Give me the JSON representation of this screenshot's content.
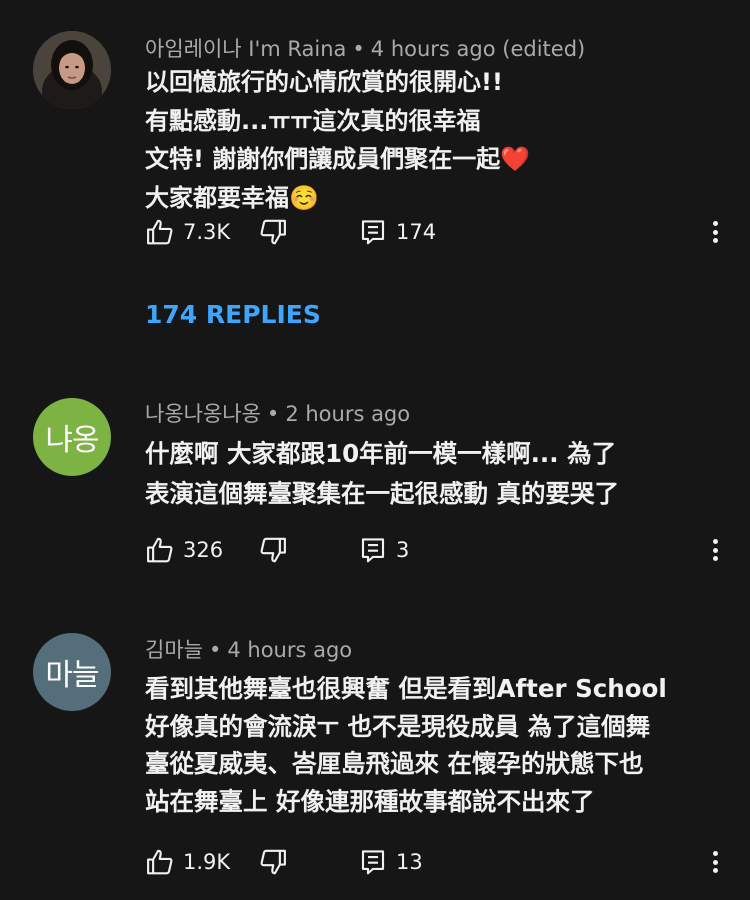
{
  "comments": [
    {
      "author": "아임레이나 I'm Raina",
      "time": "4 hours ago (edited)",
      "avatar_type": "photo",
      "avatar_color": "#3b3733",
      "lines": [
        "以回憶旅行的心情欣賞的很開心!!",
        "有點感動...ㅠㅠ這次真的很幸福",
        "文特! 謝謝你們讓成員們聚在一起❤️",
        "大家都要幸福☺️"
      ],
      "likes": "7.3K",
      "replies_count": "174"
    },
    {
      "author": "나옹나옹나옹",
      "time": "2 hours ago",
      "avatar_type": "letters",
      "avatar_text": "냐옹",
      "avatar_color": "#7cb342",
      "lines": [
        "什麼啊 大家都跟10年前一模一樣啊... 為了",
        "表演這個舞臺聚集在一起很感動 真的要哭了"
      ],
      "likes": "326",
      "replies_count": "3"
    },
    {
      "author": "김마늘",
      "time": "4 hours ago",
      "avatar_type": "letters",
      "avatar_text": "마늘",
      "avatar_color": "#546e7a",
      "lines": [
        "看到其他舞臺也很興奮 但是看到After School",
        "好像真的會流淚ㅜ 也不是現役成員 為了這個舞",
        "臺從夏威夷、峇厘島飛過來 在懷孕的狀態下也",
        "站在舞臺上 好像連那種故事都說不出來了"
      ],
      "likes": "1.9K",
      "replies_count": "13"
    }
  ],
  "view_replies": "174 REPLIES",
  "separator": "•",
  "icons": {
    "like": "thumbs-up-icon",
    "dislike": "thumbs-down-icon",
    "reply": "comment-reply-icon",
    "more": "more-vert-icon"
  },
  "colors": {
    "background": "#161616",
    "text": "#f1f1f1",
    "meta": "#aaaaaa",
    "link": "#3ea6ff"
  }
}
